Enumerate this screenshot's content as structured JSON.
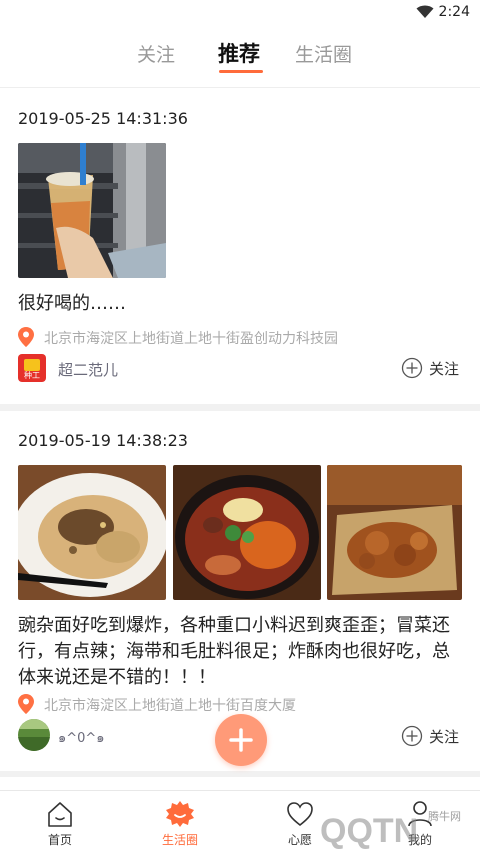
{
  "status_bar": {
    "time": "2:24"
  },
  "tabs": [
    {
      "label": "关注"
    },
    {
      "label": "推荐"
    },
    {
      "label": "生活圈"
    }
  ],
  "posts": [
    {
      "date": "2019-05-25 14:31:36",
      "text": "很好喝的……",
      "location": "北京市海淀区上地街道上地十街盈创动力科技园",
      "author": "超二范儿",
      "follow_label": "关注",
      "avatar_text": "种工"
    },
    {
      "date": "2019-05-19 14:38:23",
      "text": "豌杂面好吃到爆炸，各种重口小料迟到爽歪歪；冒菜还行，有点辣；海带和毛肚料很足；炸酥肉也很好吃，总体来说还是不错的！！！",
      "location": "北京市海淀区上地街道上地十街百度大厦",
      "author": "๑^0^๑",
      "follow_label": "关注"
    }
  ],
  "fab": {
    "icon": "plus-icon"
  },
  "bottom_nav": [
    {
      "label": "首页",
      "icon": "home-icon"
    },
    {
      "label": "生活圈",
      "icon": "life-circle-icon"
    },
    {
      "label": "心愿",
      "icon": "heart-icon"
    },
    {
      "label": "我的",
      "icon": "profile-icon"
    }
  ],
  "watermark": {
    "text": "QQTN",
    "sub": "腾牛网"
  },
  "colors": {
    "accent": "#ff6b3b",
    "fab": "#ff9a78",
    "location_pin": "#ff7043"
  }
}
